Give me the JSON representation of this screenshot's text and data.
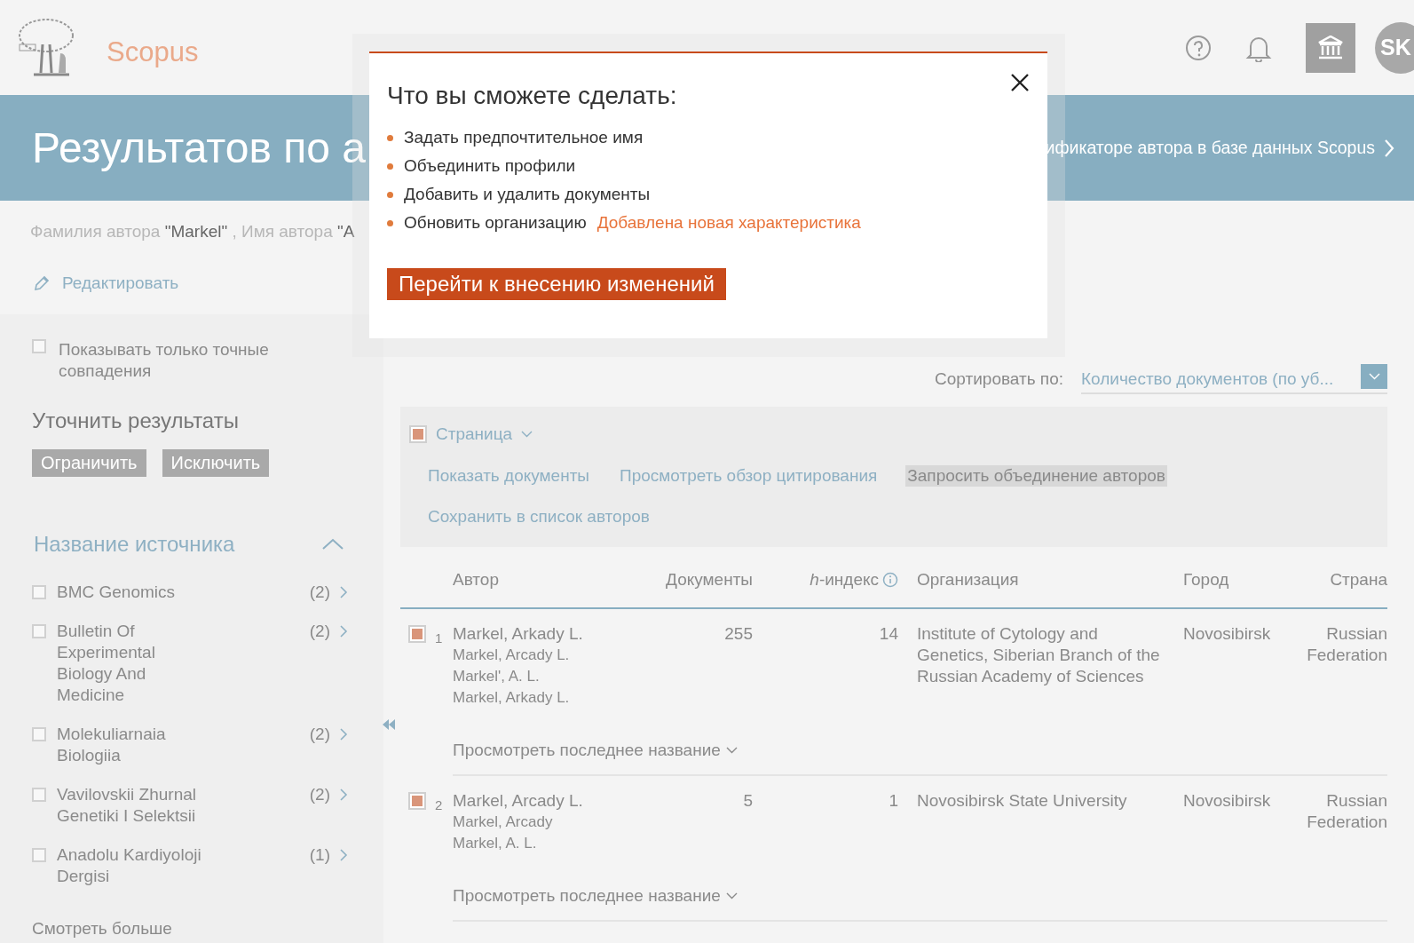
{
  "header": {
    "logo_text": "Scopus",
    "avatar": "SK"
  },
  "banner": {
    "title": "Результатов по а",
    "link": "ификаторе автора в базе данных Scopus"
  },
  "query": [
    {
      "text": "Фамилия автора ",
      "kind": "label"
    },
    {
      "text": "\"Markel\"",
      "kind": "value"
    },
    {
      "text": " , Имя автора ",
      "kind": "label"
    },
    {
      "text": "\"А",
      "kind": "value"
    }
  ],
  "edit_link": "Редактировать",
  "sidebar": {
    "exact_match": {
      "label": "Показывать только точные совпадения",
      "checked": false
    },
    "refine_title": "Уточнить результаты",
    "buttons": [
      "Ограничить",
      "Исключить"
    ],
    "facet": {
      "title": "Название источника",
      "expanded": true,
      "items": [
        {
          "label": "BMC Genomics",
          "count": "(2)",
          "checked": false
        },
        {
          "label": "Bulletin Of Experimental Biology And Medicine",
          "count": "(2)",
          "checked": false
        },
        {
          "label": "Molekuliarnaia Biologiia",
          "count": "(2)",
          "checked": false
        },
        {
          "label": "Vavilovskii Zhurnal Genetiki I Selektsii",
          "count": "(2)",
          "checked": false
        },
        {
          "label": "Anadolu Kardiyoloji Dergisi",
          "count": "(1)",
          "checked": false
        }
      ]
    },
    "more": "Смотреть больше"
  },
  "sort": {
    "label": "Сортировать по:",
    "value": "Количество документов (по уб..."
  },
  "toolbar": {
    "page": {
      "label": "Страница",
      "checked": true
    },
    "actions": [
      {
        "label": "Показать документы",
        "highlighted": false
      },
      {
        "label": "Просмотреть обзор цитирования",
        "highlighted": false
      },
      {
        "label": "Запросить объединение авторов",
        "highlighted": true
      },
      {
        "label": "Сохранить в список авторов",
        "highlighted": false
      }
    ]
  },
  "table": {
    "columns": [
      "Автор",
      "Документы",
      "*h*-индекс",
      "Организация",
      "Город",
      "Страна"
    ],
    "rows": [
      {
        "number": "1",
        "checked": true,
        "author": "Markel, Arkady L.",
        "variants": [
          "Markel, Arcady L.",
          "Markel', A. L.",
          "Markel, Arkady L."
        ],
        "documents": "255",
        "h_index": "14",
        "organization": "Institute of Cytology and Genetics, Siberian Branch of the Russian Academy of Sciences",
        "city": "Novosibirsk",
        "country": "Russian Federation",
        "more": "Просмотреть последнее название"
      },
      {
        "number": "2",
        "checked": true,
        "author": "Markel, Arcady L.",
        "variants": [
          "Markel, Arcady",
          "Markel, A. L."
        ],
        "documents": "5",
        "h_index": "1",
        "organization": "Novosibirsk State University",
        "city": "Novosibirsk",
        "country": "Russian Federation",
        "more": "Просмотреть последнее название"
      }
    ]
  },
  "modal": {
    "title": "Что вы сможете сделать:",
    "items": [
      {
        "text": "Задать предпочтительное имя"
      },
      {
        "text": "Объединить профили"
      },
      {
        "text": "Добавить и удалить документы"
      },
      {
        "text": "Обновить организацию",
        "tag": "Добавлена новая характеристика"
      }
    ],
    "button": "Перейти к внесению изменений"
  }
}
